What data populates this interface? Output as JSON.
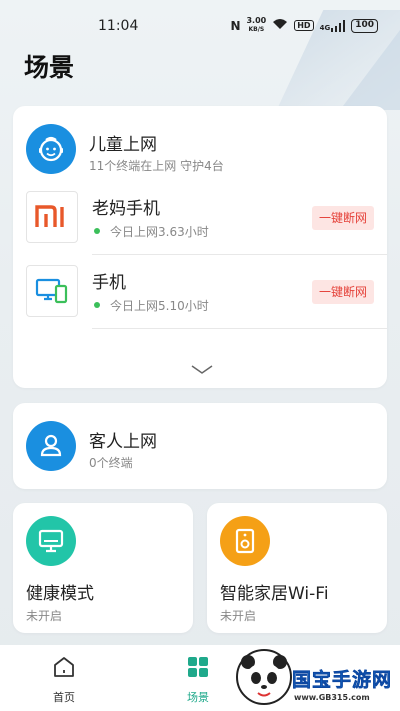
{
  "status_bar": {
    "time": "11:04",
    "net_speed_value": "3.00",
    "net_speed_unit": "KB/S",
    "hd_label": "HD",
    "signal_label": "4G",
    "battery": "100"
  },
  "page": {
    "title": "场景"
  },
  "kids_card": {
    "title": "儿童上网",
    "subtitle": "11个终端在上网  守护4台",
    "devices": [
      {
        "name": "老妈手机",
        "usage": "今日上网3.63小时",
        "action": "一键断网",
        "icon": "mi-logo-icon"
      },
      {
        "name": "手机",
        "usage": "今日上网5.10小时",
        "action": "一键断网",
        "icon": "devices-icon"
      }
    ]
  },
  "guest_card": {
    "title": "客人上网",
    "subtitle": "0个终端"
  },
  "modes": [
    {
      "title": "健康模式",
      "status": "未开启",
      "color": "#22c5a8",
      "icon": "monitor-icon"
    },
    {
      "title": "智能家居Wi-Fi",
      "status": "未开启",
      "color": "#f5a016",
      "icon": "speaker-icon"
    }
  ],
  "bottom_nav": {
    "items": [
      {
        "label": "首页",
        "icon": "home-icon",
        "active": false
      },
      {
        "label": "场景",
        "icon": "grid-icon",
        "active": true
      }
    ]
  },
  "watermark": {
    "title": "国宝手游网",
    "url": "www.GB315.com"
  },
  "colors": {
    "accent": "#1fa98b",
    "blue": "#1a8fe0",
    "danger": "#e5433b"
  }
}
